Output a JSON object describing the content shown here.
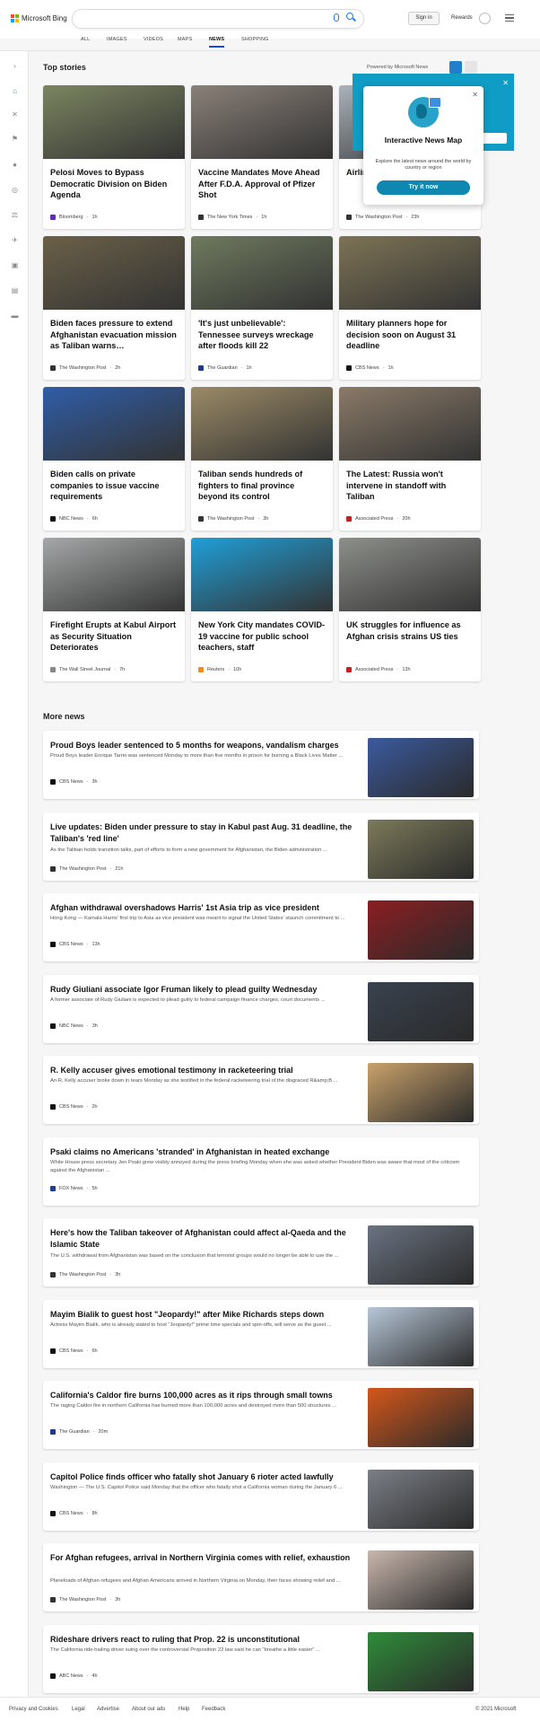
{
  "header": {
    "logo_text": "Microsoft Bing",
    "search_placeholder": "",
    "signin": "Sign in",
    "rewards": "Rewards"
  },
  "nav": [
    "ALL",
    "IMAGES",
    "VIDEOS",
    "MAPS",
    "NEWS",
    "SHOPPING"
  ],
  "nav_active": "NEWS",
  "top_stories": {
    "title": "Top stories",
    "powered_by": "Powered by Microsoft News"
  },
  "cards": [
    {
      "title": "Pelosi Moves to Bypass Democratic Division on Biden Agenda",
      "source": "Bloomberg",
      "time": "1h",
      "logo_color": "#5b2fb8",
      "img": "#7b8560"
    },
    {
      "title": "Vaccine Mandates Move Ahead After F.D.A. Approval of Pfizer Shot",
      "source": "The New York Times",
      "time": "1h",
      "logo_color": "#333",
      "img": "#8a8078"
    },
    {
      "title": "Airlines evacuate… WWII…",
      "source": "The Washington Post",
      "time": "23h",
      "logo_color": "#333",
      "img": "#aab2bb"
    },
    {
      "title": "Biden faces pressure to extend Afghanistan evacuation mission as Taliban warns…",
      "source": "The Washington Post",
      "time": "2h",
      "logo_color": "#333",
      "img": "#6b6048"
    },
    {
      "title": "'It's just unbelievable': Tennessee surveys wreckage after floods kill 22",
      "source": "The Guardian",
      "time": "1h",
      "logo_color": "#1e3a8a",
      "img": "#6e7a5e"
    },
    {
      "title": "Military planners hope for decision soon on August 31 deadline",
      "source": "CBS News",
      "time": "1h",
      "logo_color": "#111",
      "img": "#7d7355"
    },
    {
      "title": "Biden calls on private companies to issue vaccine requirements",
      "source": "NBC News",
      "time": "6h",
      "logo_color": "#111",
      "img": "#2f5da8"
    },
    {
      "title": "Taliban sends hundreds of fighters to final province beyond its control",
      "source": "The Washington Post",
      "time": "3h",
      "logo_color": "#333",
      "img": "#9b8a66"
    },
    {
      "title": "The Latest: Russia won't intervene in standoff with Taliban",
      "source": "Associated Press",
      "time": "20h",
      "logo_color": "#c81e1e",
      "img": "#8a7a68"
    },
    {
      "title": "Firefight Erupts at Kabul Airport as Security Situation Deteriorates",
      "source": "The Wall Street Journal",
      "time": "7h",
      "logo_color": "#888",
      "img": "#a5a8a8"
    },
    {
      "title": "New York City mandates COVID-19 vaccine for public school teachers, staff",
      "source": "Reuters",
      "time": "10h",
      "logo_color": "#f08a1c",
      "img": "#1f9fd8"
    },
    {
      "title": "UK struggles for influence as Afghan crisis strains US ties",
      "source": "Associated Press",
      "time": "13h",
      "logo_color": "#c81e1e",
      "img": "#8d8f8a"
    }
  ],
  "popup": {
    "title": "Interactive News Map",
    "desc": "Explore the latest news around the world by country or region",
    "button": "Try it now"
  },
  "more_news": {
    "title": "More news"
  },
  "news": [
    {
      "title": "Proud Boys leader sentenced to 5 months for weapons, vandalism charges",
      "snippet": "Proud Boys leader Enrique Tarrio was sentenced Monday to more than five months in prison for burning a Black Lives Matter ...",
      "source": "CBS News",
      "time": "3h",
      "logo_color": "#111",
      "img": "#3b5a9e"
    },
    {
      "title": "Live updates: Biden under pressure to stay in Kabul past Aug. 31 deadline, the Taliban's 'red line'",
      "snippet": "As the Taliban holds transition talks, part of efforts to form a new government for Afghanistan, the Biden administration ...",
      "source": "The Washington Post",
      "time": "21h",
      "logo_color": "#333",
      "img": "#7c7a5a"
    },
    {
      "title": "Afghan withdrawal overshadows Harris' 1st Asia trip as vice president",
      "snippet": "Hong Kong — Kamala Harris' first trip to Asia as vice president was meant to signal the United States' staunch commitment to ...",
      "source": "CBS News",
      "time": "13h",
      "logo_color": "#111",
      "img": "#8b1e22"
    },
    {
      "title": "Rudy Giuliani associate Igor Fruman likely to plead guilty Wednesday",
      "snippet": "A former associate of Rudy Giuliani is expected to plead guilty to federal campaign finance charges, court documents ...",
      "source": "NBC News",
      "time": "3h",
      "logo_color": "#111",
      "img": "#39424f"
    },
    {
      "title": "R. Kelly accuser gives emotional testimony in racketeering trial",
      "snippet": "An R. Kelly accuser broke down in tears Monday as she testified in the federal racketeering trial of the disgraced R&amp;B ...",
      "source": "CBS News",
      "time": "2h",
      "logo_color": "#111",
      "img": "#c9a26b"
    },
    {
      "title": "Psaki claims no Americans 'stranded' in Afghanistan in heated exchange",
      "snippet": "White House press secretary Jen Psaki grew visibly annoyed during the press briefing Monday when she was asked whether President Biden was aware that most of the criticism against the Afghanistan ...",
      "source": "FOX News",
      "time": "5h",
      "logo_color": "#1c3f8f",
      "img": ""
    },
    {
      "title": "Here's how the Taliban takeover of Afghanistan could affect al-Qaeda and the Islamic State",
      "snippet": "The U.S. withdrawal from Afghanistan was based on the conclusion that terrorist groups would no longer be able to use the ...",
      "source": "The Washington Post",
      "time": "3h",
      "logo_color": "#333",
      "img": "#6a7382"
    },
    {
      "title": "Mayim Bialik to guest host \"Jeopardy!\" after Mike Richards steps down",
      "snippet": "Actress Mayim Bialik, who is already slated to host \"Jeopardy!\" prime time specials and spin-offs, will serve as the guest ...",
      "source": "CBS News",
      "time": "6h",
      "logo_color": "#111",
      "img": "#b7c7d8"
    },
    {
      "title": "California's Caldor fire burns 100,000 acres as it rips through small towns",
      "snippet": "The raging Caldor fire in northern California has burned more than 100,000 acres and destroyed more than 500 structures ...",
      "source": "The Guardian",
      "time": "20m",
      "logo_color": "#1e3a8a",
      "img": "#d4571b"
    },
    {
      "title": "Capitol Police finds officer who fatally shot January 6 rioter acted lawfully",
      "snippet": "Washington — The U.S. Capitol Police said Monday that the officer who fatally shot a California woman during the January 6 ...",
      "source": "CBS News",
      "time": "8h",
      "logo_color": "#111",
      "img": "#7b7f86"
    },
    {
      "title": "For Afghan refugees, arrival in Northern Virginia comes with relief, exhaustion",
      "snippet": "Planeloads of Afghan refugees and Afghan Americans arrived in Northern Virginia on Monday, their faces showing relief and ...",
      "source": "The Washington Post",
      "time": "3h",
      "logo_color": "#333",
      "img": "#c9b7ad"
    },
    {
      "title": "Rideshare drivers react to ruling that Prop. 22 is unconstitutional",
      "snippet": "The California ride-hailing driver suing over the controversial Proposition 22 law said he can \"breathe a little easier\" ...",
      "source": "ABC News",
      "time": "4h",
      "logo_color": "#111",
      "img": "#2f8c3a"
    }
  ],
  "footer": {
    "links": [
      "Privacy and Cookies",
      "Legal",
      "Advertise",
      "About our ads",
      "Help",
      "Feedback"
    ],
    "copyright": "© 2021 Microsoft"
  },
  "colors": {
    "accent": "#174ae4",
    "teal": "#0e88b0"
  }
}
